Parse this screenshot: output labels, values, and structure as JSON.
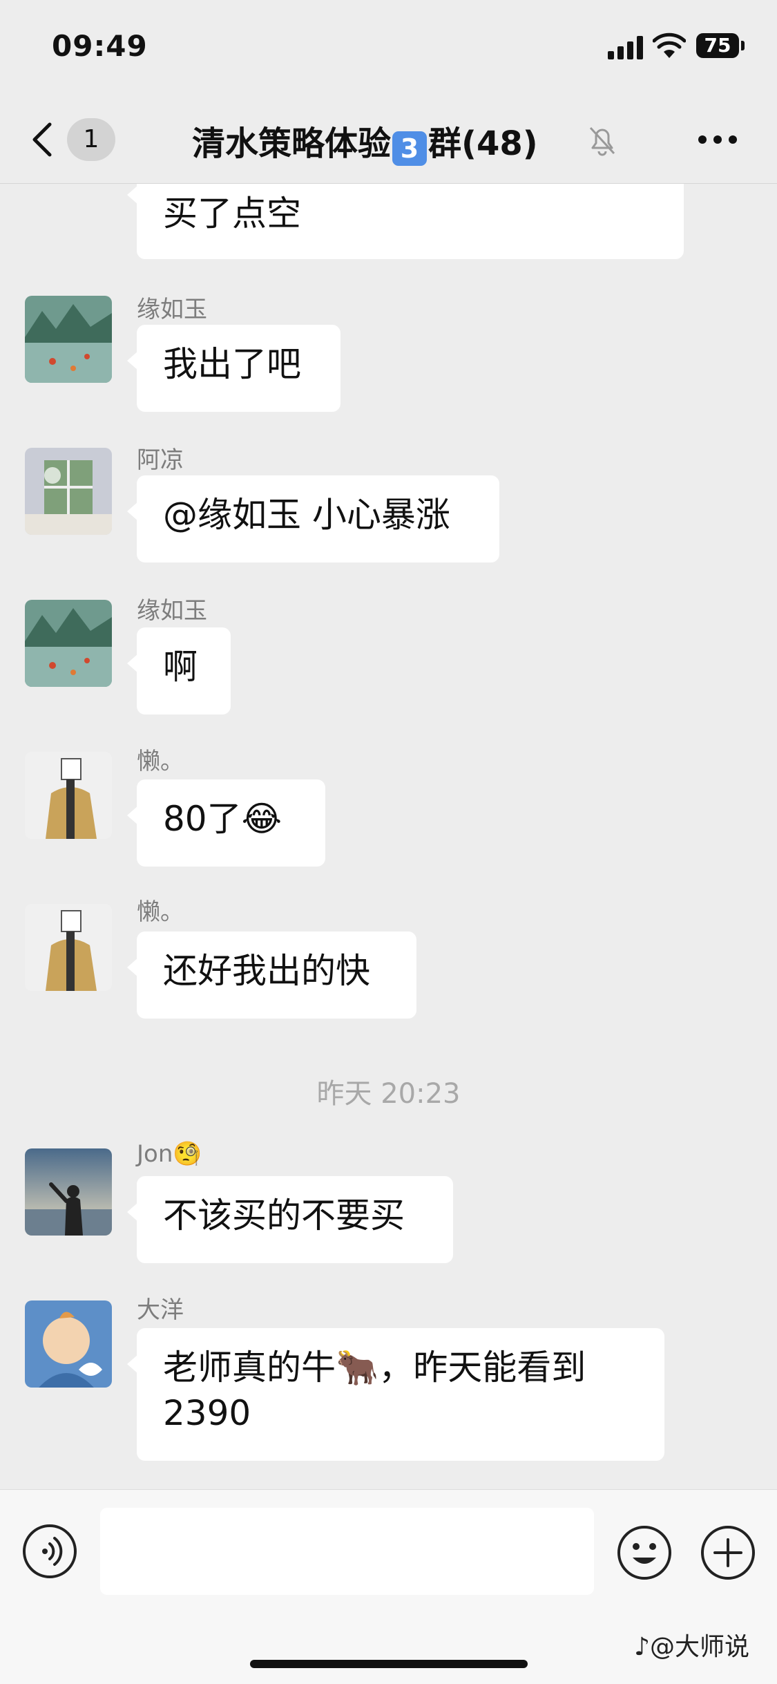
{
  "status_bar": {
    "time": "09:49",
    "battery": "75"
  },
  "nav": {
    "unread_count": "1",
    "title_prefix": "清水策略体验",
    "title_badge": "3",
    "title_suffix": "群(48)"
  },
  "partial_message": {
    "text_line1": "买了点空"
  },
  "messages": [
    {
      "sender": "缘如玉",
      "text": "我出了吧"
    },
    {
      "sender": "阿凉",
      "text": "@缘如玉 小心暴涨"
    },
    {
      "sender": "缘如玉",
      "text": "啊"
    },
    {
      "sender": "懒。",
      "text": "80了😂"
    },
    {
      "sender": "懒。",
      "text": "还好我出的快"
    },
    {
      "sender": "Jon🧐",
      "text": "不该买的不要买"
    },
    {
      "sender": "大洋",
      "text_line1": "老师真的牛🐂，昨天能看到",
      "text_line2": "2390"
    }
  ],
  "timestamp": "昨天 20:23",
  "watermark": "♪@大师说"
}
